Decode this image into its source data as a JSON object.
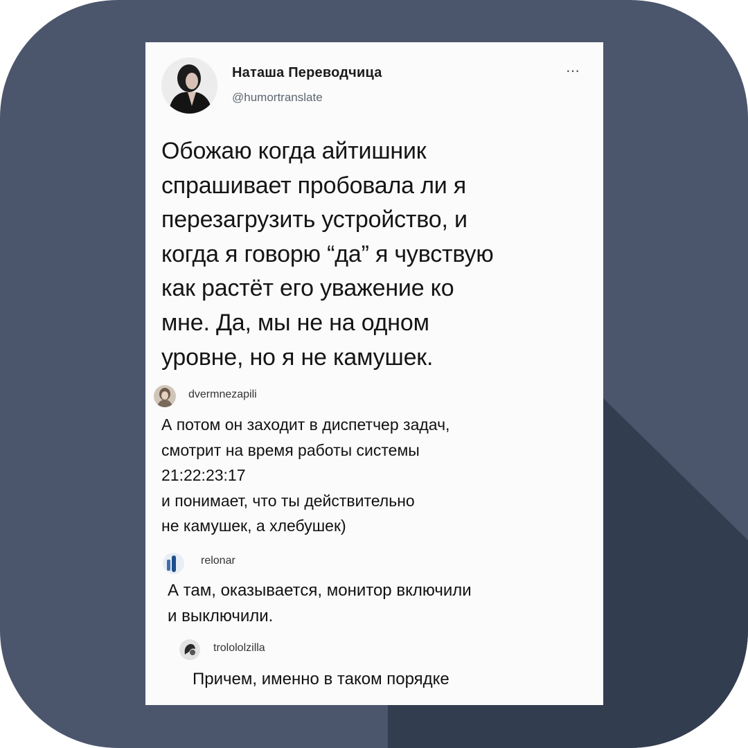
{
  "colors": {
    "frame_background": "#4b566c",
    "frame_shadow": "#333d50",
    "card_background": "#fbfbfb",
    "text_primary": "#151515",
    "text_secondary": "#5d6670"
  },
  "tweet": {
    "author_name": "Наташа Переводчица",
    "author_handle": "@humortranslate",
    "more_icon": "⋯",
    "text": "Обожаю когда айтишник\nспрашивает пробовала ли я\nперезагрузить устройство, и\nкогда я говорю “да” я чувствую\nкак растёт его уважение ко\nмне. Да, мы не на одном\nуровне, но я не камушек."
  },
  "comments": [
    {
      "username": "dvermnezapili",
      "avatar_icon": "user-avatar",
      "text": "А потом он заходит в диспетчер задач,\nсмотрит на время работы системы\n21:22:23:17\nи понимает, что ты действительно\nне камушек, а хлебушек)"
    },
    {
      "username": "relonar",
      "avatar_icon": "user-avatar",
      "text": "А там, оказывается, монитор включили\nи выключили."
    },
    {
      "username": "trolololzilla",
      "avatar_icon": "user-avatar",
      "text": "Причем, именно в таком порядке"
    }
  ]
}
